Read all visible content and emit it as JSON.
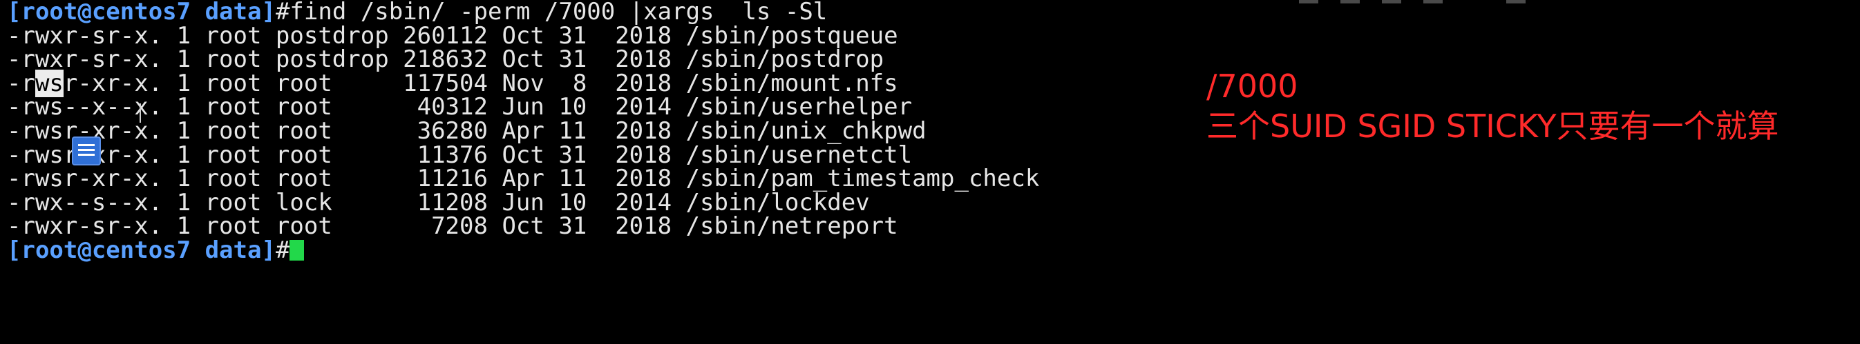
{
  "terminal": {
    "prompt": "[root@centos7 data]",
    "prompt_symbol": "#",
    "command": "find /sbin/ -perm /7000 |xargs  ls -Sl",
    "output": [
      {
        "pre": "-r",
        "hl": "ws",
        "post": "r-sr-x. 1 root postdrop 260112 Oct 31  2018 /sbin/postqueue",
        "plain": "-rwxr-sr-x. 1 root postdrop 260112 Oct 31  2018 /sbin/postqueue"
      },
      {
        "plain": "-rwxr-sr-x. 1 root postdrop 218632 Oct 31  2018 /sbin/postdrop"
      },
      {
        "plain": "-rwsr-xr-x. 1 root root     117504 Nov  8  2018 /sbin/mount.nfs"
      },
      {
        "plain": "-rws--x--x. 1 root root      40312 Jun 10  2014 /sbin/userhelper"
      },
      {
        "plain": "-rwsr-xr-x. 1 root root      36280 Apr 11  2018 /sbin/unix_chkpwd"
      },
      {
        "plain": "-rwsr-xr-x. 1 root root      11376 Oct 31  2018 /sbin/usernetctl"
      },
      {
        "plain": "-rwsr-xr-x. 1 root root      11216 Apr 11  2018 /sbin/pam_timestamp_check"
      },
      {
        "plain": "-rwx--s--x. 1 root lock      11208 Jun 10  2014 /sbin/lockdev"
      },
      {
        "plain": "-rwxr-sr-x. 1 root root       7208 Oct 31  2018 /sbin/netreport"
      }
    ],
    "highlight": {
      "line": 2,
      "pre": "-r",
      "sel": "ws",
      "post": "r-xr-x. 1 root root     117504 Nov  8  2018 /sbin/mount.nfs"
    }
  },
  "annotation": {
    "line1": "/7000",
    "line2": "三个SUID SGID STICKY只要有一个就算"
  },
  "colors": {
    "background": "#000000",
    "text": "#e6e6e6",
    "prompt": "#5aa0ff",
    "cursor": "#22d84a",
    "annotation": "#ff2a2a",
    "selection": "#ececec"
  },
  "icons": [
    "text-cursor-icon",
    "document-icon"
  ]
}
